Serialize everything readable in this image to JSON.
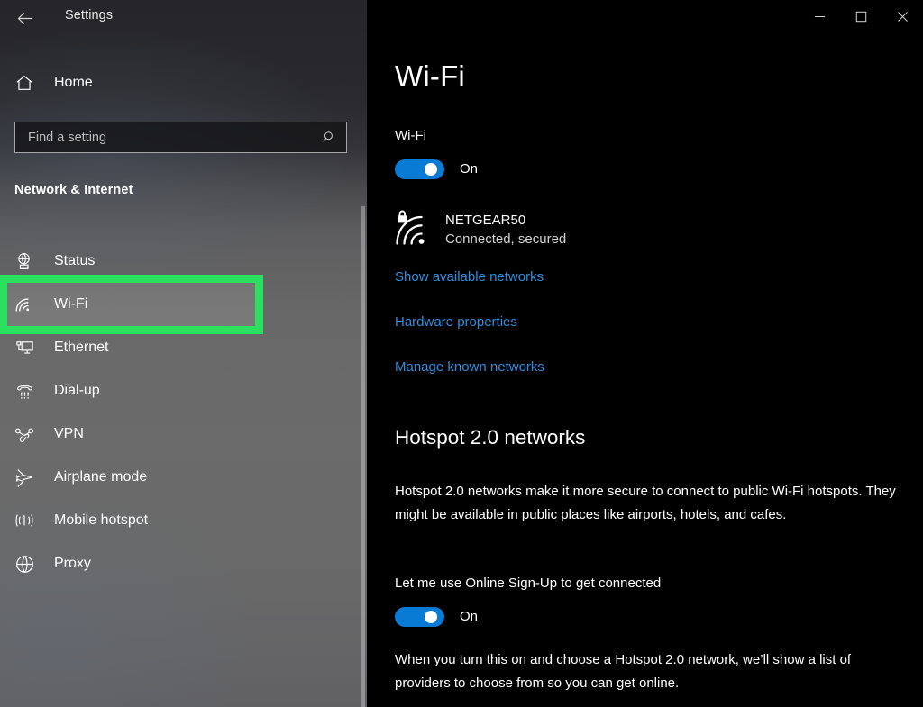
{
  "window": {
    "title": "Settings",
    "back_icon": "back-arrow-icon",
    "controls": [
      {
        "name": "minimize-button",
        "glyph": "─"
      },
      {
        "name": "maximize-button",
        "glyph": "□"
      },
      {
        "name": "close-button",
        "glyph": "✕"
      }
    ]
  },
  "sidebar": {
    "home": {
      "label": "Home",
      "icon": "home-icon"
    },
    "search": {
      "value": "",
      "placeholder": "Find a setting",
      "icon": "search-icon"
    },
    "category": "Network & Internet",
    "items": [
      {
        "label": "Status",
        "icon": "status-globe-icon",
        "selected": false
      },
      {
        "label": "Wi-Fi",
        "icon": "wifi-icon",
        "selected": true
      },
      {
        "label": "Ethernet",
        "icon": "ethernet-icon",
        "selected": false
      },
      {
        "label": "Dial-up",
        "icon": "dialup-phone-icon",
        "selected": false
      },
      {
        "label": "VPN",
        "icon": "vpn-knot-icon",
        "selected": false
      },
      {
        "label": "Airplane mode",
        "icon": "airplane-icon",
        "selected": false
      },
      {
        "label": "Mobile hotspot",
        "icon": "mobile-hotspot-icon",
        "selected": false
      },
      {
        "label": "Proxy",
        "icon": "proxy-globe-icon",
        "selected": false
      }
    ],
    "highlight": {
      "target": "Wi-Fi",
      "color": "#2ae05e"
    }
  },
  "main": {
    "page_title": "Wi-Fi",
    "wifi_toggle": {
      "label": "Wi-Fi",
      "state": "On",
      "on": true
    },
    "network": {
      "name": "NETGEAR50",
      "status": "Connected, secured",
      "icon": "wifi-secured-icon"
    },
    "links": [
      {
        "label": "Show available networks"
      },
      {
        "label": "Hardware properties"
      },
      {
        "label": "Manage known networks"
      }
    ],
    "hotspot": {
      "heading": "Hotspot 2.0 networks",
      "description": "Hotspot 2.0 networks make it more secure to connect to public Wi-Fi hotspots. They might be available in public places like airports, hotels, and cafes.",
      "toggle": {
        "label": "Let me use Online Sign-Up to get connected",
        "state": "On",
        "on": true
      },
      "footnote": "When you turn this on and choose a Hotspot 2.0 network, we’ll show a list of providers to choose from so you can get online."
    }
  },
  "colors": {
    "accent": "#0a7bd4",
    "link": "#2d8fe0",
    "highlight": "#2ae05e",
    "main_bg": "#000000"
  }
}
